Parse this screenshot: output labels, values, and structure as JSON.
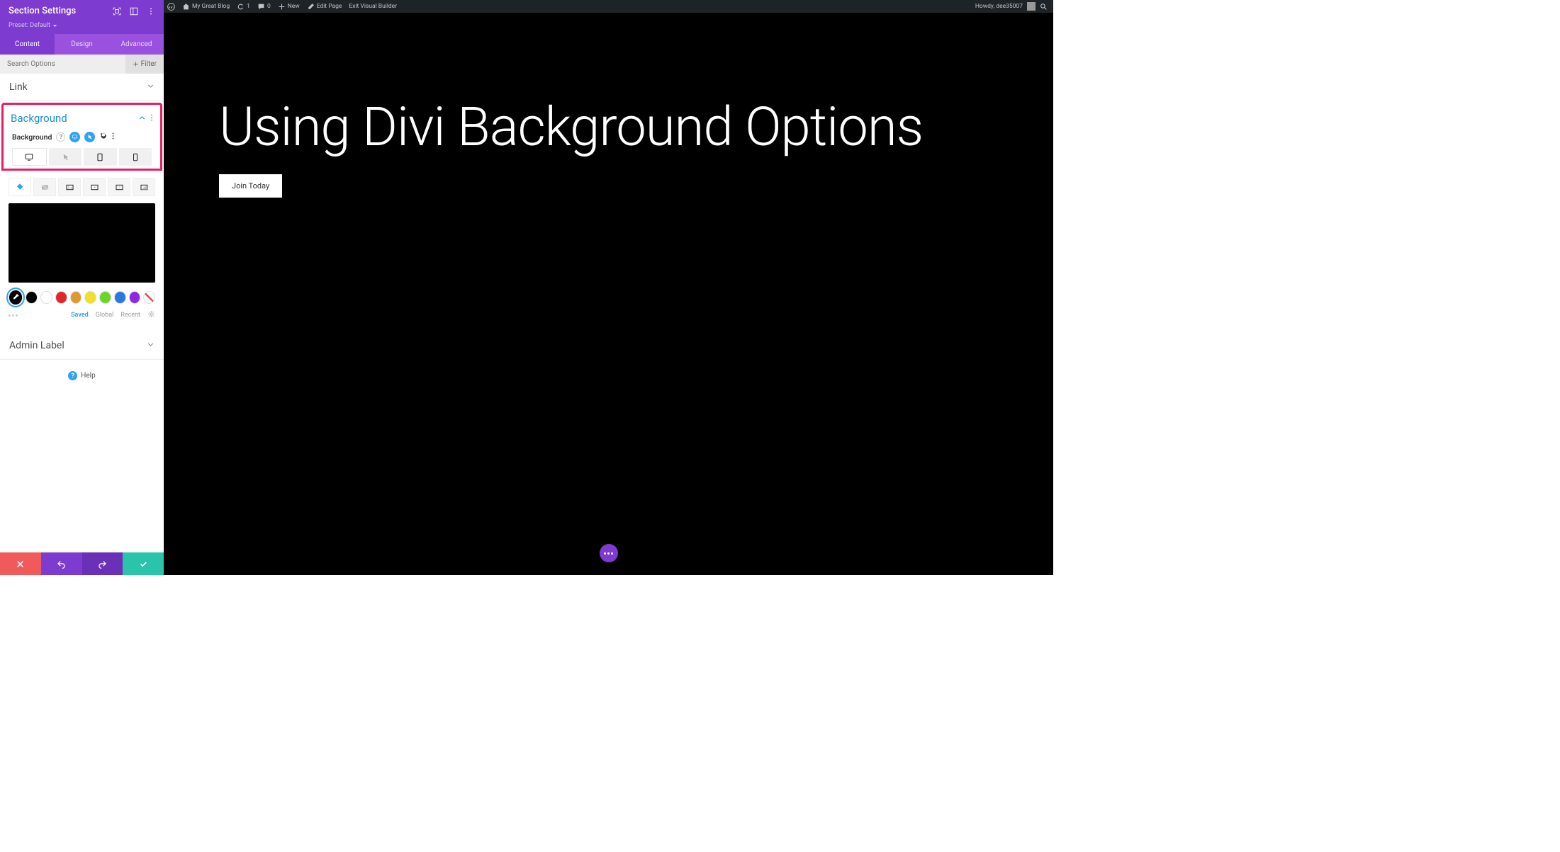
{
  "admin_bar": {
    "site_name": "My Great Blog",
    "updates": "1",
    "comments": "0",
    "new": "New",
    "edit_page": "Edit Page",
    "exit_vb": "Exit Visual Builder",
    "howdy": "Howdy, dee35007"
  },
  "panel": {
    "title": "Section Settings",
    "preset": "Preset: Default",
    "tabs": {
      "content": "Content",
      "design": "Design",
      "advanced": "Advanced"
    },
    "search_placeholder": "Search Options",
    "filter": "Filter",
    "sections": {
      "link": "Link",
      "background": "Background",
      "admin_label": "Admin Label"
    },
    "bg_label": "Background",
    "swatches": [
      "#000000",
      "#ffffff",
      "#e02828",
      "#e09828",
      "#f0e028",
      "#6cd628",
      "#2878e0",
      "#9028e0"
    ],
    "palette_tabs": {
      "saved": "Saved",
      "global": "Global",
      "recent": "Recent"
    },
    "help": "Help"
  },
  "hero": {
    "heading": "Using Divi Background Options",
    "cta": "Join Today"
  }
}
